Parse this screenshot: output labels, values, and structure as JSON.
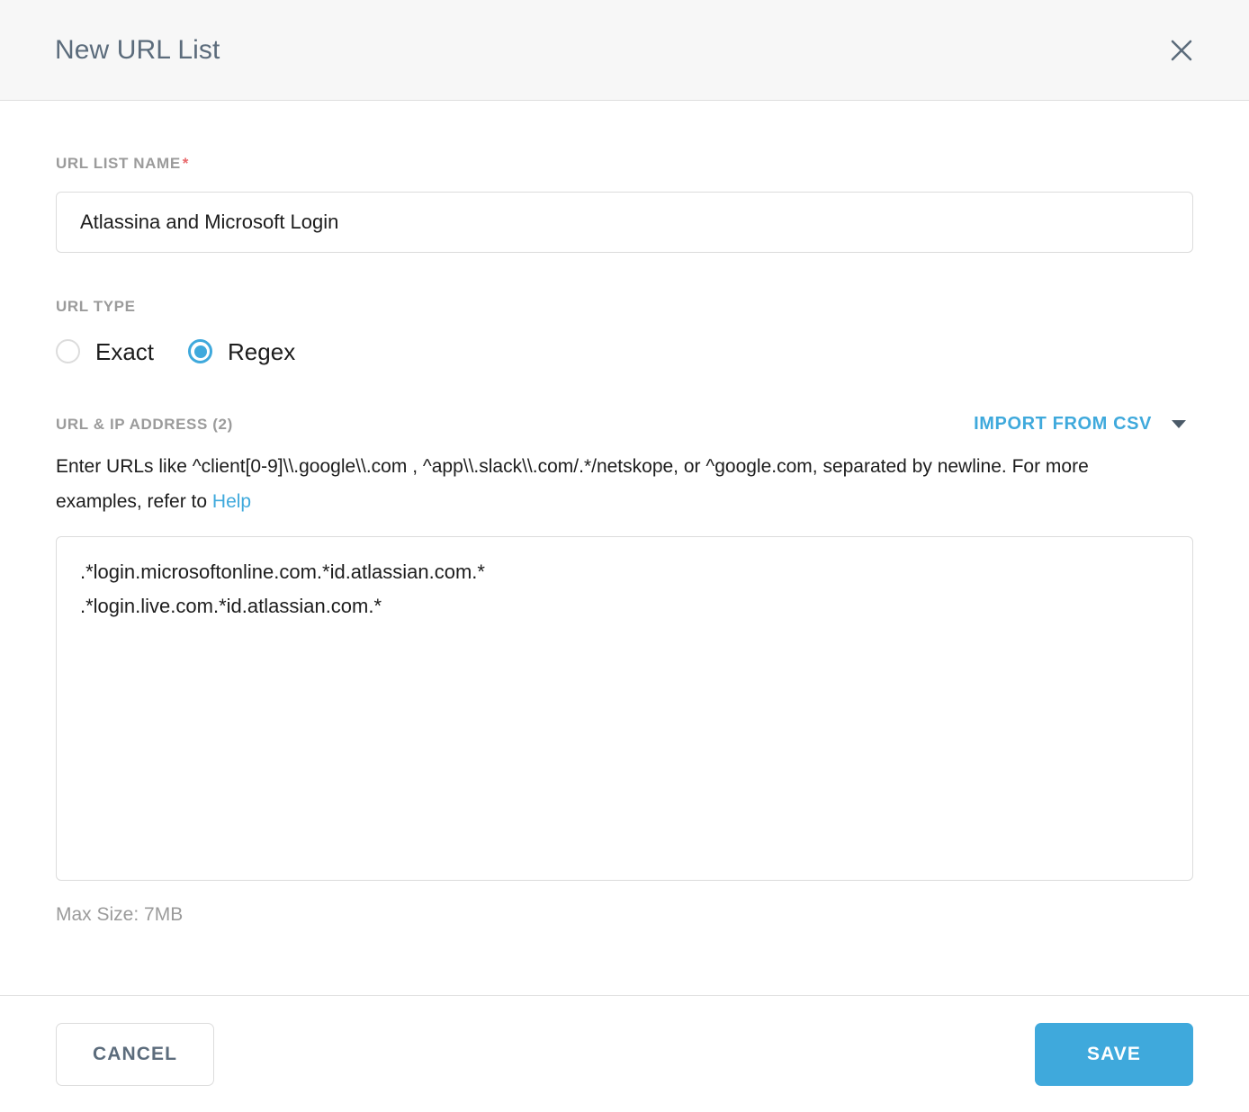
{
  "dialog": {
    "title": "New URL List",
    "close_icon": "close-icon"
  },
  "name_field": {
    "label": "URL LIST NAME",
    "required_marker": "*",
    "value": "Atlassina and Microsoft Login",
    "placeholder": ""
  },
  "url_type": {
    "label": "URL TYPE",
    "options": [
      {
        "label": "Exact",
        "selected": false
      },
      {
        "label": "Regex",
        "selected": true
      }
    ]
  },
  "urls_section": {
    "label": "URL & IP ADDRESS (2)",
    "count": 2,
    "import_label": "IMPORT FROM CSV",
    "import_caret_icon": "chevron-down-icon",
    "helper_text_before": "Enter URLs like ^client[0-9]\\\\.google\\\\.com , ^app\\\\.slack\\\\.com/.*/netskope, or ^google.com, separated by newline. For more examples, refer to ",
    "help_link_label": "Help",
    "textarea_value": ".*login.microsoftonline.com.*id.atlassian.com.*\n.*login.live.com.*id.atlassian.com.*",
    "textarea_placeholder": "",
    "max_size_note": "Max Size: 7MB"
  },
  "footer": {
    "cancel_label": "CANCEL",
    "save_label": "SAVE"
  },
  "colors": {
    "accent_blue": "#3fa9dc",
    "title_slate": "#5c6c7c",
    "label_gray": "#9b9b9b",
    "required_red": "#e8686b",
    "header_bg": "#f7f7f7",
    "border_gray": "#dcdcdc"
  }
}
